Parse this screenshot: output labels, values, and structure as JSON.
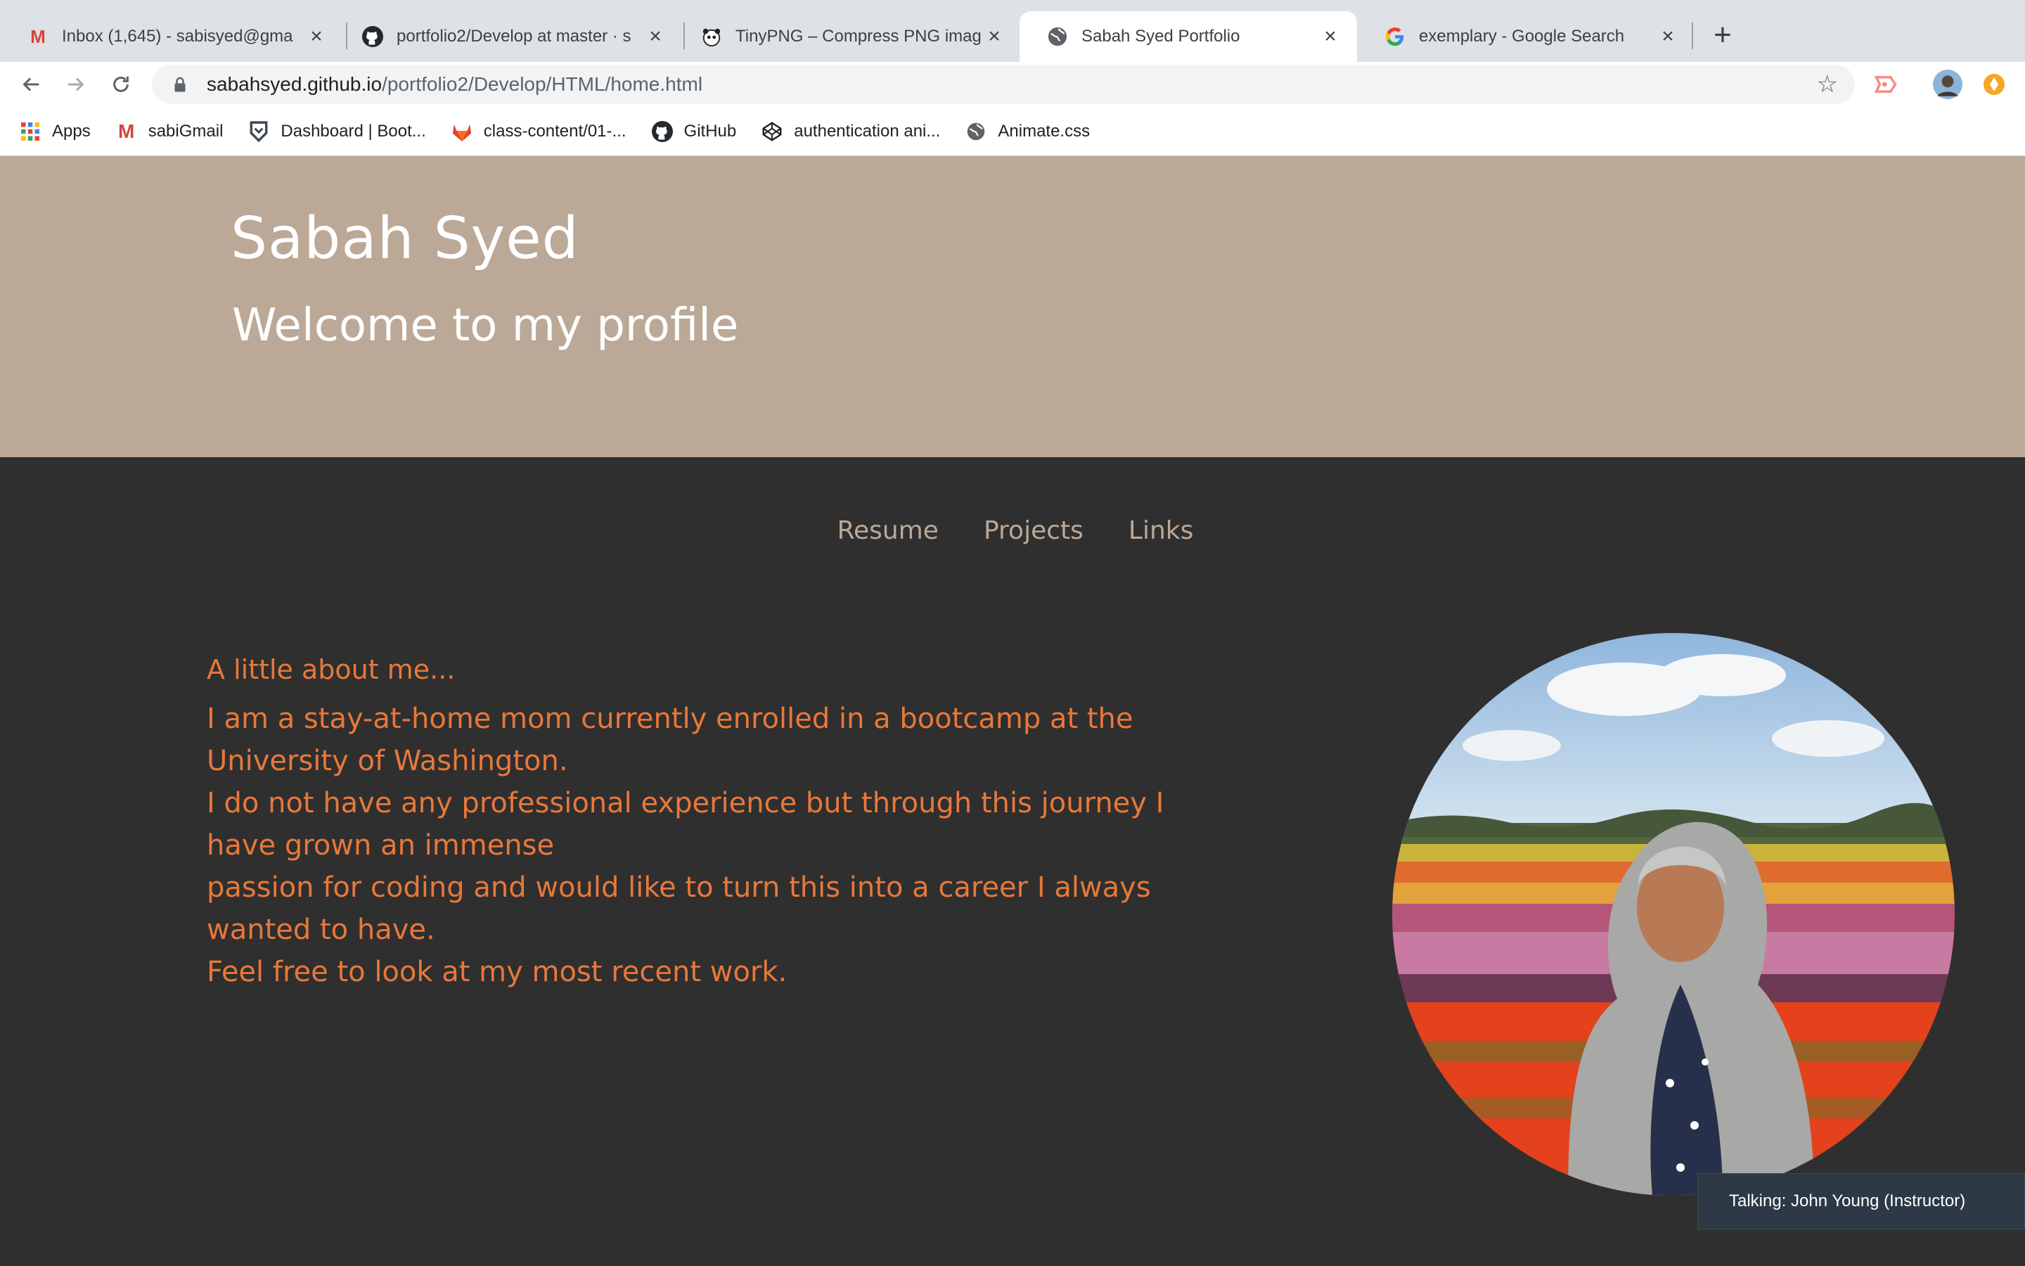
{
  "browser": {
    "tabs": [
      {
        "title": "Inbox (1,645) - sabisyed@gma",
        "icon": "gmail-icon"
      },
      {
        "title": "portfolio2/Develop at master · s",
        "icon": "github-icon"
      },
      {
        "title": "TinyPNG – Compress PNG imag",
        "icon": "panda-icon"
      },
      {
        "title": "Sabah Syed Portfolio",
        "icon": "globe-icon",
        "active": true
      },
      {
        "title": "exemplary - Google Search",
        "icon": "google-icon"
      }
    ],
    "url_host": "sabahsyed.github.io",
    "url_path": "/portfolio2/Develop/HTML/home.html",
    "bookmarks": [
      {
        "label": "Apps",
        "icon": "apps-grid-icon"
      },
      {
        "label": "sabiGmail",
        "icon": "gmail-icon"
      },
      {
        "label": "Dashboard | Boot...",
        "icon": "bootcamp-shield-icon"
      },
      {
        "label": "class-content/01-...",
        "icon": "gitlab-icon"
      },
      {
        "label": "GitHub",
        "icon": "github-icon"
      },
      {
        "label": "authentication ani...",
        "icon": "codepen-icon"
      },
      {
        "label": "Animate.css",
        "icon": "globe-icon"
      }
    ]
  },
  "page": {
    "name": "Sabah Syed",
    "welcome": "Welcome to my profile",
    "nav": [
      "Resume",
      "Projects",
      "Links"
    ],
    "about_heading": "A little about me...",
    "about_lines": [
      "I am a stay-at-home mom currently enrolled in a bootcamp at the University of Washington.",
      "I do not have any professional experience but through this journey I have grown an immense",
      "passion for coding and would like to turn this into a career I always wanted to have.",
      "Feel free to look at my most recent work."
    ]
  },
  "toast": {
    "text": "Talking: John Young (Instructor)"
  },
  "colors": {
    "hero_bg": "#bca897",
    "page_bg": "#2f2f2f",
    "accent_text": "#e8783a",
    "nav_text": "#bca897"
  }
}
